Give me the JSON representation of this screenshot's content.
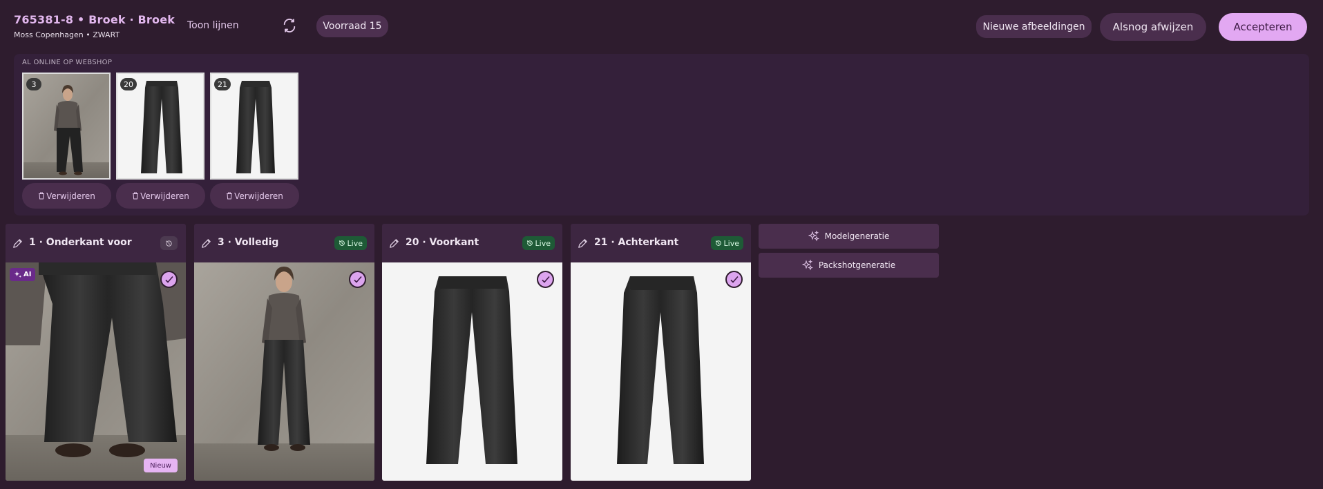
{
  "header": {
    "title": "765381-8 • Broek · Broek",
    "subtitle": "Moss Copenhagen • ZWART",
    "toon_lijnen": "Toon lijnen",
    "voorraad": "Voorraad 15",
    "btn_nieuwe": "Nieuwe afbeeldingen",
    "btn_afwijzen": "Alsnog afwijzen",
    "btn_accepteren": "Accepteren"
  },
  "online": {
    "label": "AL ONLINE OP WEBSHOP",
    "delete_label": "Verwijderen",
    "thumbs": [
      {
        "badge": "3"
      },
      {
        "badge": "20"
      },
      {
        "badge": "21"
      }
    ]
  },
  "cards": [
    {
      "title": "1 · Onderkant voor",
      "status": "",
      "ai": "AI",
      "new": "Nieuw"
    },
    {
      "title": "3 · Volledig",
      "status": "Live"
    },
    {
      "title": "20 · Voorkant",
      "status": "Live"
    },
    {
      "title": "21 · Achterkant",
      "status": "Live"
    }
  ],
  "generation": {
    "model": "Modelgeneratie",
    "packshot": "Packshotgeneratie"
  },
  "colors": {
    "background": "#2e1c2e",
    "accent": "#e2a8f2",
    "live": "#1e5a36"
  }
}
